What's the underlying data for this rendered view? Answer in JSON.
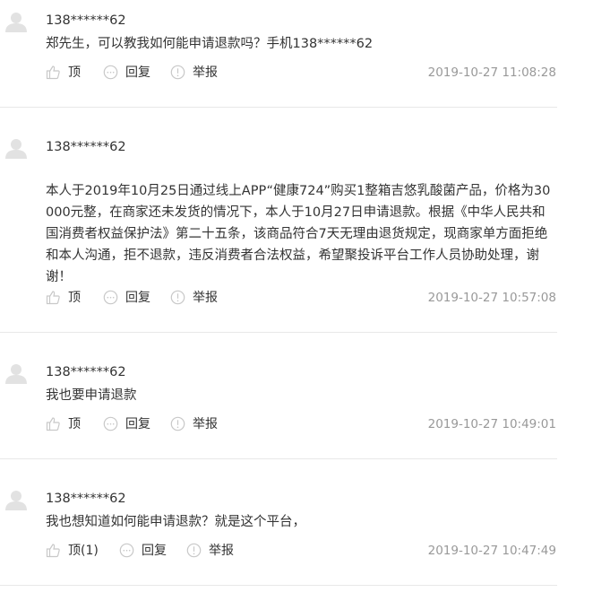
{
  "icons": {
    "avatar": "user-avatar-icon",
    "like": "thumbs-up-icon",
    "reply": "chat-bubble-icon",
    "report": "exclamation-circle-icon"
  },
  "colors": {
    "text": "#333333",
    "meta": "#999999",
    "icon": "#cccccc",
    "divider": "#e8e8e8"
  },
  "comments": [
    {
      "user": "138******62",
      "text": "郑先生，可以教我如何能申请退款吗？手机138******62",
      "like_label": "顶",
      "reply_label": "回复",
      "report_label": "举报",
      "timestamp": "2019-10-27 11:08:28"
    },
    {
      "user": "138******62",
      "text": "本人于2019年10月25日通过线上APP“健康724”购买1整箱吉悠乳酸菌产品，价格为30000元整，在商家还未发货的情况下，本人于10月27日申请退款。根据《中华人民共和国消费者权益保护法》第二十五条，该商品符合7天无理由退货规定，现商家单方面拒绝和本人沟通，拒不退款，违反消费者合法权益，希望聚投诉平台工作人员协助处理，谢谢！",
      "like_label": "顶",
      "reply_label": "回复",
      "report_label": "举报",
      "timestamp": "2019-10-27 10:57:08"
    },
    {
      "user": "138******62",
      "text": "我也要申请退款",
      "like_label": "顶",
      "reply_label": "回复",
      "report_label": "举报",
      "timestamp": "2019-10-27 10:49:01"
    },
    {
      "user": "138******62",
      "text": "我也想知道如何能申请退款？就是这个平台，",
      "like_label": "顶(1)",
      "reply_label": "回复",
      "report_label": "举报",
      "timestamp": "2019-10-27 10:47:49"
    }
  ]
}
